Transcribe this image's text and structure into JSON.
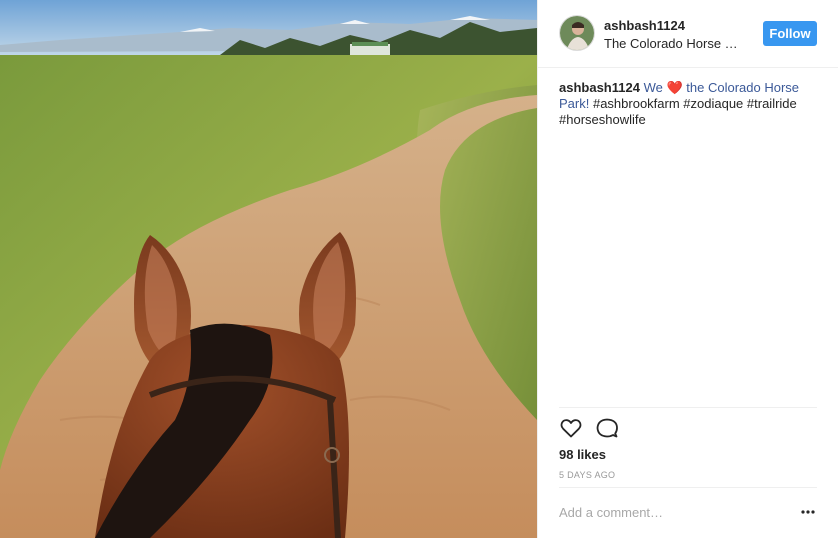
{
  "post": {
    "username": "ashbash1124",
    "location": "The Colorado Horse …",
    "follow_label": "Follow"
  },
  "caption": {
    "username": "ashbash1124",
    "text_we": "We",
    "heart": "❤️",
    "link_text": "the Colorado Horse Park!",
    "hashtags": "#ashbrookfarm #zodiaque #trailride #horseshowlife"
  },
  "actions": {
    "like_icon": "heart-outline-icon",
    "comment_icon": "comment-bubble-icon"
  },
  "likes": "98 likes",
  "timestamp": "5 DAYS AGO",
  "comment": {
    "placeholder": "Add a comment…"
  },
  "colors": {
    "follow_button": "#3897f0",
    "link": "#3b5998",
    "border": "#efefef",
    "muted": "#999999"
  }
}
